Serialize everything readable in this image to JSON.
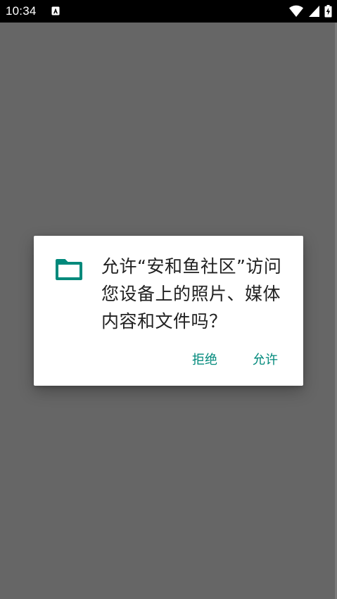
{
  "status_bar": {
    "time": "10:34",
    "notification_icon": "a-icon",
    "wifi_icon": "wifi-icon",
    "signal_icon": "signal-icon",
    "battery_icon": "battery-charging-icon"
  },
  "dialog": {
    "icon": "folder-icon",
    "message": "允许“安和鱼社区”访问您设备上的照片、媒体内容和文件吗？",
    "deny_label": "拒绝",
    "allow_label": "允许"
  },
  "colors": {
    "accent": "#00897b",
    "scrim": "#666666",
    "status_bar": "#000000",
    "dialog_background": "#ffffff",
    "text": "#212121"
  }
}
